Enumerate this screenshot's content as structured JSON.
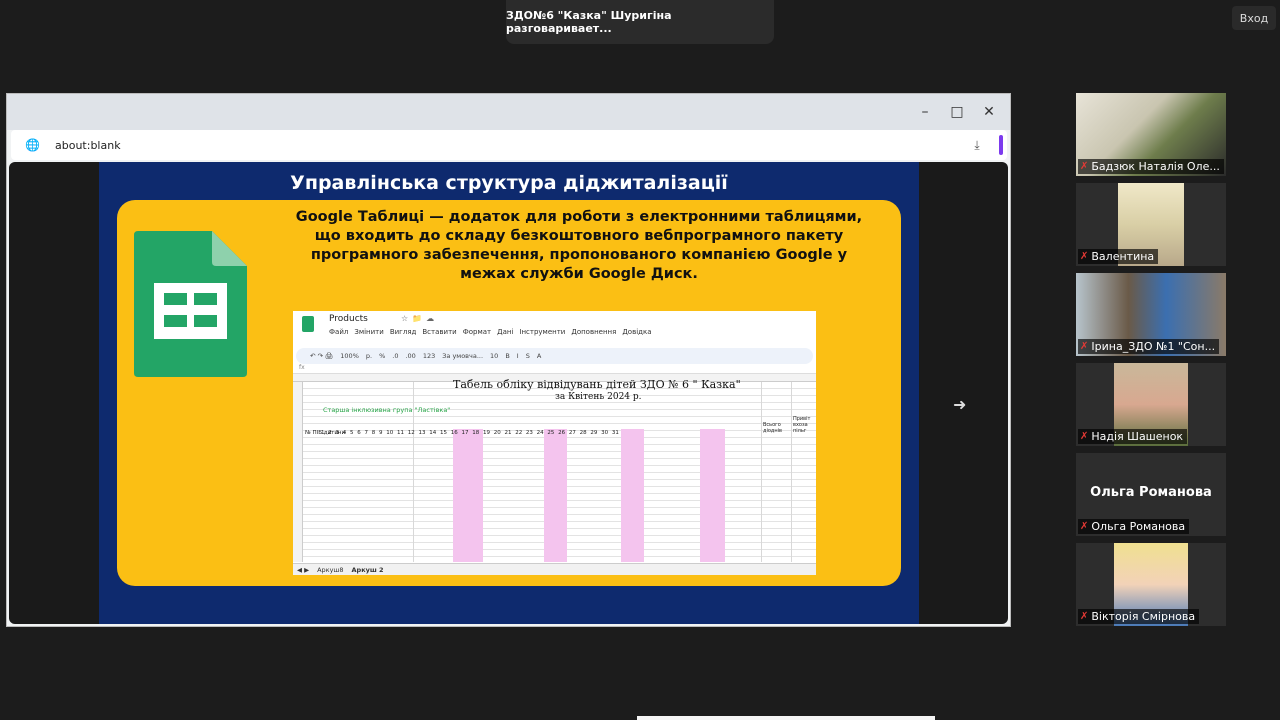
{
  "meeting": {
    "banner_text": "ЗДО№6 \"Казка\" Шуригіна разговаривает...",
    "enter_label": "Вход"
  },
  "browser": {
    "url": "about:blank",
    "icons": [
      "minimize-icon",
      "maximize-icon",
      "close-icon",
      "globe-icon",
      "download-icon"
    ]
  },
  "slide": {
    "title": "Управлінська структура діджиталізації",
    "description": "Google Таблиці — додаток для роботи з електронними таблицями, що входить до складу безкоштовного вебпрограмного пакету програмного забезпечення, пропонованого компанією Google у межах служби Google Диск.",
    "colors": {
      "background": "#0e2a6e",
      "card": "#fbbf14",
      "sheets_green": "#23a566"
    }
  },
  "sheet": {
    "doc_title": "Products",
    "menu": [
      "Файл",
      "Змінити",
      "Вигляд",
      "Вставити",
      "Формат",
      "Дані",
      "Інструменти",
      "Доповнення",
      "Довідка"
    ],
    "toolbar": [
      "100%",
      "р.",
      "%",
      ".0",
      ".00",
      "123",
      "За умовча...",
      "10",
      "B",
      "I",
      "S",
      "A"
    ],
    "formula_prefix": "fx",
    "tabel_title": "Табель обліку відвідувань дітей ЗДО № 6 \" Казка\"",
    "tabel_subtitle": "за Квітень 2024 р.",
    "group_label": "Старша інклюзивна група \"Ластівка\"",
    "name_header": "№ ПІБ дитини",
    "day_numbers": "1 2 3 4 5 6 7 8 9 10 11 12 13 14 15 16 17 18 19 20 21 22 23 24 25 26 27 28 29 30 31",
    "total_header": "Всього діоднів",
    "extra_header": "Привіт вхоза пільг",
    "tabs": [
      "Аркуш8",
      "Аркуш 2"
    ]
  },
  "participants": [
    {
      "name": "Бадзюк Наталія Оле...",
      "muted": true
    },
    {
      "name": "Валентина",
      "muted": true
    },
    {
      "name": "Ірина_ЗДО №1 \"Сон...",
      "muted": true
    },
    {
      "name": "Надія Шашенок",
      "muted": true
    },
    {
      "name": "Ольга Романова",
      "muted": true,
      "display_name": "Ольга Романова"
    },
    {
      "name": "Вікторія Смірнова",
      "muted": true
    }
  ]
}
